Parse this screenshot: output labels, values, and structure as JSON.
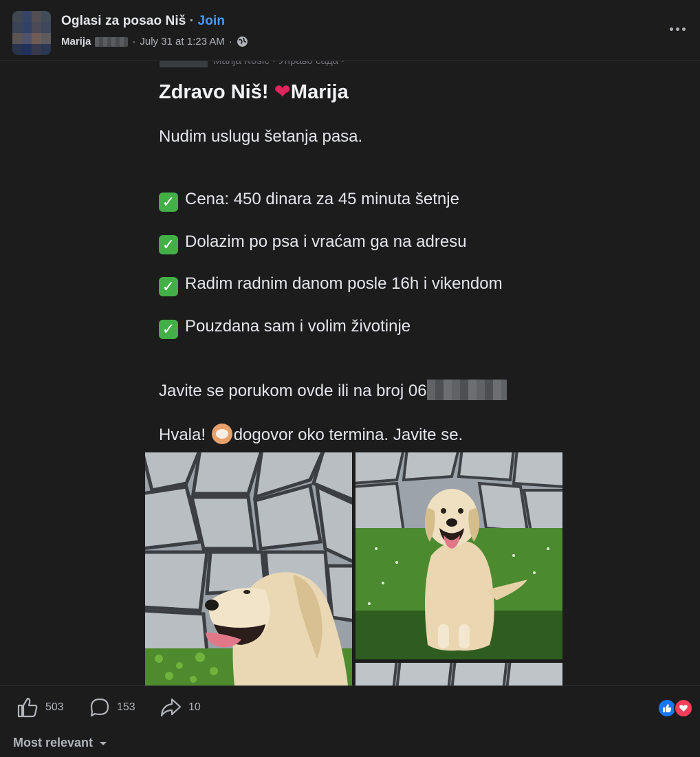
{
  "header": {
    "group_name": "Oglasi za posao Niš",
    "separator": "·",
    "join_label": "Join",
    "author": "Marija",
    "timestamp": "July 31 at 1:23 AM",
    "meta_separator": "·"
  },
  "post": {
    "cutoff_text": "Marija Kosic · Управо сада ·",
    "greeting": "Zdravo Niš!",
    "signature": "Marija",
    "intro": "Nudim uslugu šetanja pasa.",
    "features": [
      "Cena: 450 dinara za 45 minuta šetnje",
      "Dolazim po psa i vraćam ga na adresu",
      "Radim radnim danom posle 16h i vikendom",
      "Pouzdana sam i volim životinje"
    ],
    "contact_prefix": "Javite se porukom ovde ili na broj 06",
    "thanks_prefix": "Hvala!",
    "thanks_suffix": "dogovor oko termina. Javite se."
  },
  "stats": {
    "likes": "503",
    "comments": "153",
    "shares": "10"
  },
  "comments": {
    "sort_label": "Most relevant"
  },
  "icons": [
    "globe-icon",
    "more-options-icon",
    "heart-icon",
    "check-icon",
    "like-icon",
    "comment-icon",
    "share-icon",
    "like-reaction-icon",
    "love-reaction-icon",
    "dropdown-arrow-icon"
  ],
  "colors": {
    "background": "#1c1c1d",
    "accent": "#4599ff",
    "text": "#e4e6eb",
    "muted": "#b0b3b8",
    "check": "#43b047",
    "love": "#f33e58",
    "like": "#1877f2"
  }
}
